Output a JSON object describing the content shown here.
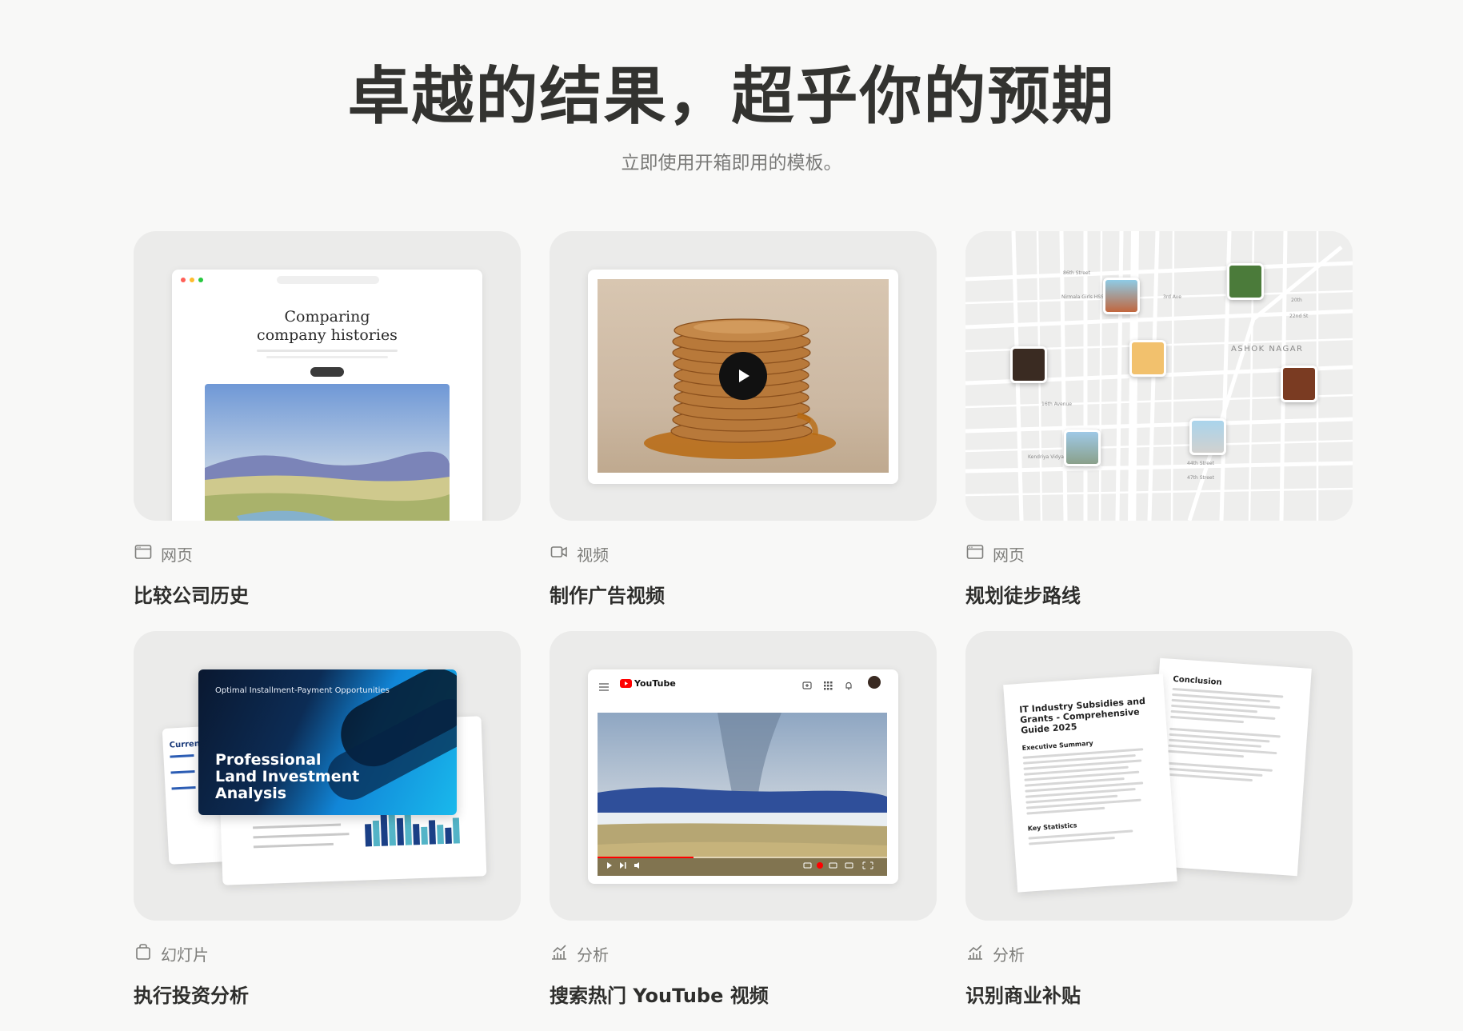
{
  "hero": {
    "title": "卓越的结果，超乎你的预期",
    "subtitle": "立即使用开箱即用的模板。"
  },
  "cards": [
    {
      "category": "网页",
      "category_icon": "browser-icon",
      "title": "比较公司历史",
      "preview_heading": "Comparing\ncompany histories"
    },
    {
      "category": "视频",
      "category_icon": "video-camera-icon",
      "title": "制作广告视频"
    },
    {
      "category": "网页",
      "category_icon": "browser-icon",
      "title": "规划徒步路线",
      "map_labels": [
        "86th Street",
        "3rd Ave",
        "ASHOK NAGAR",
        "16th Avenue",
        "Kendriya Vidyalaya",
        "44th Street",
        "47th Street",
        "Nirmala Girls HSS",
        "22nd St",
        "20th"
      ]
    },
    {
      "category": "幻灯片",
      "category_icon": "slides-icon",
      "title": "执行投资分析",
      "slide_kicker": "Optimal Installment-Payment Opportunities",
      "slide_title": "Professional\nLand Investment\nAnalysis",
      "back_slide_heading": "Current"
    },
    {
      "category": "分析",
      "category_icon": "analytics-icon",
      "title": "搜索热门 YouTube 视频",
      "yt_brand": "YouTube"
    },
    {
      "category": "分析",
      "category_icon": "analytics-icon",
      "title": "识别商业补贴",
      "doc_title": "IT Industry Subsidies and Grants - Comprehensive Guide 2025",
      "doc_section": "Executive Summary",
      "doc_section2": "Key Statistics",
      "doc2_title": "Conclusion"
    }
  ],
  "colors": {
    "background": "#f8f8f7",
    "card": "#ebebea",
    "yt_red": "#ff0000"
  }
}
